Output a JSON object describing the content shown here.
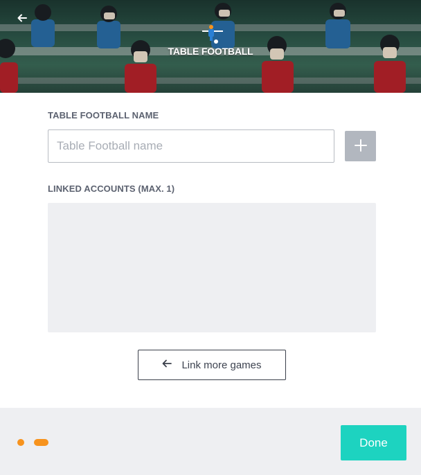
{
  "header": {
    "title": "TABLE FOOTBALL",
    "back_icon": "arrow-left-icon",
    "title_icon": "foosball-player-icon"
  },
  "form": {
    "name_label": "TABLE FOOTBALL NAME",
    "name_placeholder": "Table Football name",
    "name_value": "",
    "add_icon": "plus-icon",
    "linked_label": "LINKED ACCOUNTS (MAX. 1)",
    "link_more_label": "Link more games",
    "link_more_icon": "arrow-left-icon"
  },
  "footer": {
    "done_label": "Done",
    "steps_total": 2,
    "current_step": 2
  },
  "colors": {
    "accent": "#1dd3c0",
    "step_indicator": "#f7931e",
    "disabled_button": "#b2b7bf",
    "panel_bg": "#eeeff2"
  }
}
